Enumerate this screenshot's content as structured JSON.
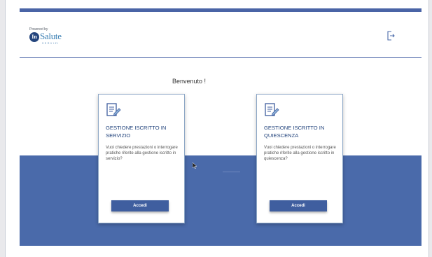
{
  "header": {
    "logo_powered": "Powered by",
    "logo_initials": "In",
    "logo_word": "Salute",
    "logo_sub": "SERVIZI"
  },
  "welcome": "Benvenuto !",
  "cards": [
    {
      "title": "GESTIONE ISCRITTO IN SERVIZIO",
      "description": "Vuoi chiedere prestazioni o interrogare pratiche riferite alla gestione iscritto in servizio?",
      "button": "Accedi"
    },
    {
      "title": "GESTIONE ISCRITTO IN QUIESCENZA",
      "description": "Vuoi chiedere prestazioni o interrogare pratiche riferite alla gestione iscritto in quiescenza?",
      "button": "Accedi"
    }
  ],
  "colors": {
    "brand_blue": "#4a64a6",
    "band_blue": "#4a6aaa",
    "title_blue": "#24457d"
  },
  "icons": {
    "exit": "logout-icon",
    "card": "document-edit-icon"
  }
}
